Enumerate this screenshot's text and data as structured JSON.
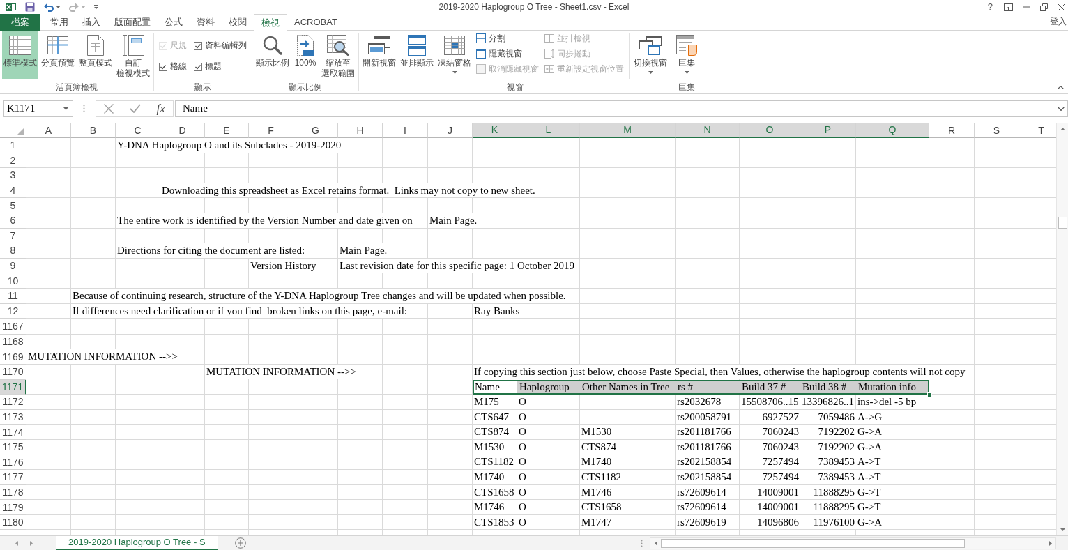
{
  "window": {
    "title": "2019-2020 Haplogroup O Tree - Sheet1.csv - Excel",
    "help": "?"
  },
  "ribbon": {
    "tabs": [
      {
        "label": "檔案",
        "kind": "file",
        "selected": false
      },
      {
        "label": "常用",
        "kind": "tab",
        "selected": false
      },
      {
        "label": "插入",
        "kind": "tab",
        "selected": false
      },
      {
        "label": "版面配置",
        "kind": "tab",
        "selected": false
      },
      {
        "label": "公式",
        "kind": "tab",
        "selected": false
      },
      {
        "label": "資料",
        "kind": "tab",
        "selected": false
      },
      {
        "label": "校閱",
        "kind": "tab",
        "selected": false
      },
      {
        "label": "檢視",
        "kind": "tab",
        "selected": true
      },
      {
        "label": "ACROBAT",
        "kind": "tab",
        "selected": false
      }
    ],
    "sign_in": "登入",
    "groups": [
      {
        "label": "活頁簿檢視",
        "items": [
          {
            "kind": "large",
            "label": "標準模式",
            "selected": true,
            "disabled": false,
            "menu": false
          },
          {
            "kind": "large",
            "label": "分頁預覽",
            "selected": false,
            "disabled": false,
            "menu": false
          },
          {
            "kind": "large",
            "label": "整頁模式",
            "selected": false,
            "disabled": false,
            "menu": false
          },
          {
            "kind": "large",
            "lines": [
              "自訂",
              "檢視模式"
            ],
            "selected": false,
            "disabled": false,
            "menu": false
          }
        ]
      },
      {
        "label": "顯示",
        "items": [
          {
            "kind": "checkbox",
            "label": "尺規",
            "checked": true,
            "disabled": true
          },
          {
            "kind": "checkbox",
            "label": "資料編輯列",
            "checked": true,
            "disabled": false
          },
          {
            "kind": "checkbox",
            "label": "格線",
            "checked": true,
            "disabled": false
          },
          {
            "kind": "checkbox",
            "label": "標題",
            "checked": true,
            "disabled": false
          }
        ]
      },
      {
        "label": "顯示比例",
        "items": [
          {
            "kind": "large",
            "label": "顯示比例",
            "selected": false,
            "disabled": false,
            "menu": false
          },
          {
            "kind": "large",
            "label": "100%",
            "selected": false,
            "disabled": false,
            "menu": false
          },
          {
            "kind": "large",
            "lines": [
              "縮放至",
              "選取範圍"
            ],
            "selected": false,
            "disabled": false,
            "menu": false
          }
        ]
      },
      {
        "label": "視窗",
        "items": [
          {
            "kind": "large",
            "label": "開新視窗",
            "selected": false,
            "disabled": false,
            "menu": false
          },
          {
            "kind": "large",
            "label": "並排顯示",
            "selected": false,
            "disabled": false,
            "menu": false
          },
          {
            "kind": "large",
            "label": "凍結窗格",
            "selected": false,
            "disabled": false,
            "menu": true
          },
          {
            "kind": "small",
            "label": "分割",
            "disabled": false
          },
          {
            "kind": "small",
            "label": "隱藏視窗",
            "disabled": false
          },
          {
            "kind": "small",
            "label": "取消隱藏視窗",
            "disabled": true
          },
          {
            "kind": "small",
            "label": "並排檢視",
            "disabled": true
          },
          {
            "kind": "small",
            "label": "同步捲動",
            "disabled": true
          },
          {
            "kind": "small",
            "label": "重新設定視窗位置",
            "disabled": true
          },
          {
            "kind": "large",
            "label": "切換視窗",
            "selected": false,
            "disabled": false,
            "menu": true
          }
        ]
      },
      {
        "label": "巨集",
        "items": [
          {
            "kind": "large",
            "label": "巨集",
            "selected": false,
            "disabled": false,
            "menu": true
          }
        ]
      }
    ]
  },
  "formula_bar": {
    "name_box": "K1171",
    "function_button": "fx",
    "formula": "Name"
  },
  "sheet": {
    "columns": [
      {
        "label": "A",
        "selected": false
      },
      {
        "label": "B",
        "selected": false
      },
      {
        "label": "C",
        "selected": false
      },
      {
        "label": "D",
        "selected": false
      },
      {
        "label": "E",
        "selected": false
      },
      {
        "label": "F",
        "selected": false
      },
      {
        "label": "G",
        "selected": false
      },
      {
        "label": "H",
        "selected": false
      },
      {
        "label": "I",
        "selected": false
      },
      {
        "label": "J",
        "selected": false
      },
      {
        "label": "K",
        "selected": true
      },
      {
        "label": "L",
        "selected": true
      },
      {
        "label": "M",
        "selected": true
      },
      {
        "label": "N",
        "selected": true
      },
      {
        "label": "O",
        "selected": true
      },
      {
        "label": "P",
        "selected": true
      },
      {
        "label": "Q",
        "selected": true
      },
      {
        "label": "R",
        "selected": false
      },
      {
        "label": "S",
        "selected": false
      },
      {
        "label": "T",
        "selected": false
      }
    ],
    "frozen_rows": [
      {
        "number": "1",
        "selected": false,
        "cells": {
          "C": "Y-DNA Haplogroup O and its Subclades - 2019-2020"
        }
      },
      {
        "number": "2",
        "selected": false
      },
      {
        "number": "3",
        "selected": false
      },
      {
        "number": "4",
        "selected": false,
        "cells": {
          "D": "Downloading this spreadsheet as Excel retains format.  Links may not copy to new sheet."
        }
      },
      {
        "number": "5",
        "selected": false
      },
      {
        "number": "6",
        "selected": false,
        "cells": {
          "C": "The entire work is identified by the Version Number and date given on",
          "J": "Main Page."
        }
      },
      {
        "number": "7",
        "selected": false
      },
      {
        "number": "8",
        "selected": false,
        "cells": {
          "C": "Directions for citing the document are listed:",
          "H": "Main Page."
        }
      },
      {
        "number": "9",
        "selected": false,
        "cells": {
          "F": "Version History",
          "H": "Last revision date for this specific page: 1 October 2019"
        }
      },
      {
        "number": "10",
        "selected": false
      },
      {
        "number": "11",
        "selected": false,
        "cells": {
          "B": "Because of continuing research, structure of the Y-DNA Haplogroup Tree changes and will be updated when possible."
        }
      },
      {
        "number": "12",
        "selected": false,
        "cells": {
          "B": "If differences need clarification or if you find  broken links on this page, e-mail:",
          "K": "Ray Banks"
        }
      }
    ],
    "rows": [
      {
        "number": "1167",
        "selected": false
      },
      {
        "number": "1168",
        "selected": false
      },
      {
        "number": "1169",
        "selected": false,
        "cells": {
          "A": "MUTATION INFORMATION -->>"
        }
      },
      {
        "number": "1170",
        "selected": false,
        "cells": {
          "E": "MUTATION INFORMATION -->>",
          "K": "If copying this section just below, choose Paste Special, then Values, otherwise the haplogroup contents will not copy"
        }
      },
      {
        "number": "1171",
        "selected": true,
        "cells": {
          "K": {
            "text": "Name",
            "active": true
          },
          "L": {
            "text": "Haplogroup",
            "active": false
          },
          "M": {
            "text": "Other Names in Tree",
            "active": false
          },
          "N": {
            "text": "rs #",
            "active": false
          },
          "O": {
            "text": "Build 37 #",
            "active": false
          },
          "P": {
            "text": "Build 38 #",
            "active": false
          },
          "Q": {
            "text": "Mutation info",
            "active": false
          }
        }
      },
      {
        "number": "1172",
        "selected": false,
        "cells": {
          "K": "M175",
          "L": "O",
          "N": "rs2032678",
          "O": "15508706..15",
          "P": "13396826..1",
          "Q": "ins->del -5 bp"
        }
      },
      {
        "number": "1173",
        "selected": false,
        "cells": {
          "K": "CTS647",
          "L": "O",
          "N": "rs200058791",
          "O": {
            "text": "6927527",
            "kind": "number"
          },
          "P": {
            "text": "7059486",
            "kind": "number"
          },
          "Q": "A->G"
        }
      },
      {
        "number": "1174",
        "selected": false,
        "cells": {
          "K": "CTS874",
          "L": "O",
          "M": "M1530",
          "N": "rs201181766",
          "O": {
            "text": "7060243",
            "kind": "number"
          },
          "P": {
            "text": "7192202",
            "kind": "number"
          },
          "Q": "G->A"
        }
      },
      {
        "number": "1175",
        "selected": false,
        "cells": {
          "K": "M1530",
          "L": "O",
          "M": "CTS874",
          "N": "rs201181766",
          "O": {
            "text": "7060243",
            "kind": "number"
          },
          "P": {
            "text": "7192202",
            "kind": "number"
          },
          "Q": "G->A"
        }
      },
      {
        "number": "1176",
        "selected": false,
        "cells": {
          "K": "CTS1182",
          "L": "O",
          "M": "M1740",
          "N": "rs202158854",
          "O": {
            "text": "7257494",
            "kind": "number"
          },
          "P": {
            "text": "7389453",
            "kind": "number"
          },
          "Q": "A->T"
        }
      },
      {
        "number": "1177",
        "selected": false,
        "cells": {
          "K": "M1740",
          "L": "O",
          "M": "CTS1182",
          "N": "rs202158854",
          "O": {
            "text": "7257494",
            "kind": "number"
          },
          "P": {
            "text": "7389453",
            "kind": "number"
          },
          "Q": "A->T"
        }
      },
      {
        "number": "1178",
        "selected": false,
        "cells": {
          "K": "CTS1658",
          "L": "O",
          "M": "M1746",
          "N": "rs72609614",
          "O": {
            "text": "14009001",
            "kind": "number"
          },
          "P": {
            "text": "11888295",
            "kind": "number"
          },
          "Q": "G->T"
        }
      },
      {
        "number": "1179",
        "selected": false,
        "cells": {
          "K": "M1746",
          "L": "O",
          "M": "CTS1658",
          "N": "rs72609614",
          "O": {
            "text": "14009001",
            "kind": "number"
          },
          "P": {
            "text": "11888295",
            "kind": "number"
          },
          "Q": "G->T"
        }
      },
      {
        "number": "1180",
        "selected": false,
        "cells": {
          "K": "CTS1853",
          "L": "O",
          "M": "M1747",
          "N": "rs72609619",
          "O": {
            "text": "14096806",
            "kind": "number"
          },
          "P": {
            "text": "11976100",
            "kind": "number"
          },
          "Q": "G->A"
        }
      }
    ]
  },
  "sheet_tabs": [
    {
      "label": "2019-2020 Haplogroup O Tree - S",
      "selected": true
    }
  ]
}
